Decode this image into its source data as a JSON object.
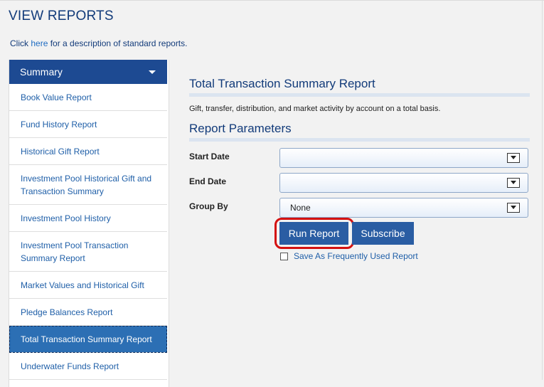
{
  "page": {
    "title": "VIEW REPORTS",
    "intro_prefix": "Click ",
    "intro_link": "here",
    "intro_suffix": " for a description of standard reports."
  },
  "sidebar": {
    "header": "Summary",
    "items": [
      {
        "label": "Book Value Report"
      },
      {
        "label": "Fund History Report"
      },
      {
        "label": "Historical Gift Report"
      },
      {
        "label": "Investment Pool Historical Gift and Transaction Summary"
      },
      {
        "label": "Investment Pool History"
      },
      {
        "label": "Investment Pool Transaction Summary Report"
      },
      {
        "label": "Market Values and Historical Gift"
      },
      {
        "label": "Pledge Balances Report"
      },
      {
        "label": "Total Transaction Summary Report"
      },
      {
        "label": "Underwater Funds Report"
      }
    ],
    "active_index": 8
  },
  "report": {
    "title": "Total Transaction Summary Report",
    "description": "Gift, transfer, distribution, and market activity by account on a total basis.",
    "params_title": "Report Parameters",
    "start_date_label": "Start Date",
    "start_date_value": "",
    "end_date_label": "End Date",
    "end_date_value": "",
    "group_by_label": "Group By",
    "group_by_value": "None",
    "run_button": "Run Report",
    "subscribe_button": "Subscribe",
    "save_label": "Save As Frequently Used Report"
  },
  "colors": {
    "header_blue": "#1d4a92",
    "button_blue": "#2a5da3",
    "highlight_red": "#d41111",
    "active_item": "#2c6fb4"
  }
}
